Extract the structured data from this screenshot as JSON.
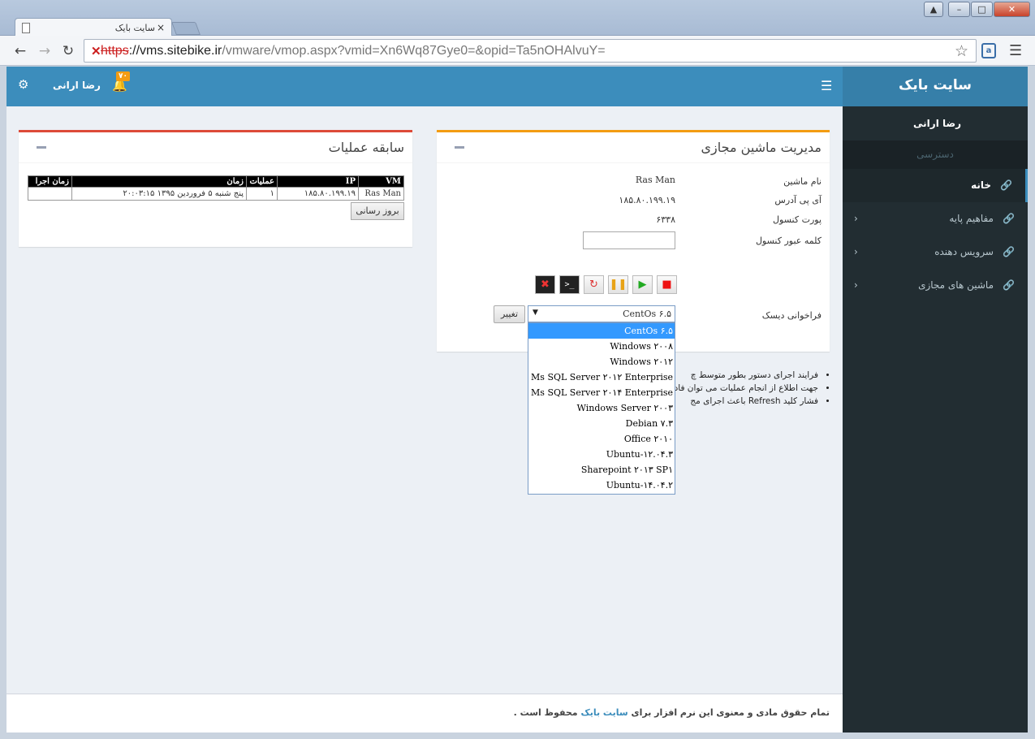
{
  "browser": {
    "tab_title": "سایت بایک",
    "tab_close": "×",
    "url_scheme": "https",
    "url_host": "://vms.sitebike.ir",
    "url_path": "/vmware/vmop.aspx?vmid=Xn6Wq87Gye0=&opid=Ta5nOHAlvuY="
  },
  "header": {
    "logo": "سایت بایک",
    "user_name": "رضا ارانی",
    "notification_count": "۷۰"
  },
  "sidebar": {
    "user": "رضا ارانی",
    "section_header": "دسترسی",
    "items": [
      {
        "label": "خانه"
      },
      {
        "label": "مفاهیم پایه"
      },
      {
        "label": "سرویس دهنده"
      },
      {
        "label": "ماشین های مجازی"
      }
    ]
  },
  "vm_box": {
    "title": "مدیریت ماشین مجازی",
    "fields": [
      {
        "label": "نام ماشین",
        "value": "Ras Man"
      },
      {
        "label": "آی پی آدرس",
        "value": "۱۸۵.۸۰.۱۹۹.۱۹"
      },
      {
        "label": "پورت کنسول",
        "value": "۶۳۳۸"
      },
      {
        "label": "کلمه عبور کنسول",
        "value": ""
      }
    ],
    "disk_label": "فراخوانی دیسک",
    "disk_selected": "CentOs ۶.۵",
    "change_button": "تغییر",
    "disk_options": [
      "CentOs ۶.۵",
      "Windows ۲۰۰۸",
      "Windows ۲۰۱۲",
      "Ms SQL Server ۲۰۱۲ Enterprise",
      "Ms SQL Server ۲۰۱۴ Enterprise",
      "Windows Server ۲۰۰۳",
      "Debian ۷.۳",
      "Office ۲۰۱۰",
      "Ubuntu-۱۲.۰۴.۳",
      "Sharepoint ۲۰۱۳ SP۱",
      "Ubuntu-۱۴.۰۴.۲"
    ]
  },
  "history_box": {
    "title": "سابقه عملیات",
    "columns": [
      "VM",
      "IP",
      "عملیات",
      "زمان",
      "زمان اجرا"
    ],
    "rows": [
      [
        "Ras Man",
        "۱۸۵.۸۰.۱۹۹.۱۹",
        "۱",
        "پنج شنبه ۵ فروردین ۱۳۹۵ ۲۰:۰۳:۱۵",
        ""
      ]
    ],
    "refresh_button": "بروز رسانی"
  },
  "notes": [
    "فرایند اجرای دستور بطور متوسط چ",
    "جهت اطلاع از انجام عملیات می توان                                   فاده از کلید بروز رسانی کنترل نمایید.",
    "فشار کلید Refresh باعث اجرای مج"
  ],
  "footer": {
    "text_before": "تمام حقوق مادی و معنوی این نرم افزار برای",
    "link": "سایت بایک",
    "text_after": "محفوظ است ."
  },
  "colors": {
    "header": "#3c8dbc",
    "sidebar": "#222d32",
    "vm_box_border": "#f39c12",
    "history_box_border": "#dd4b39",
    "dropdown_selected": "#3399ff"
  }
}
